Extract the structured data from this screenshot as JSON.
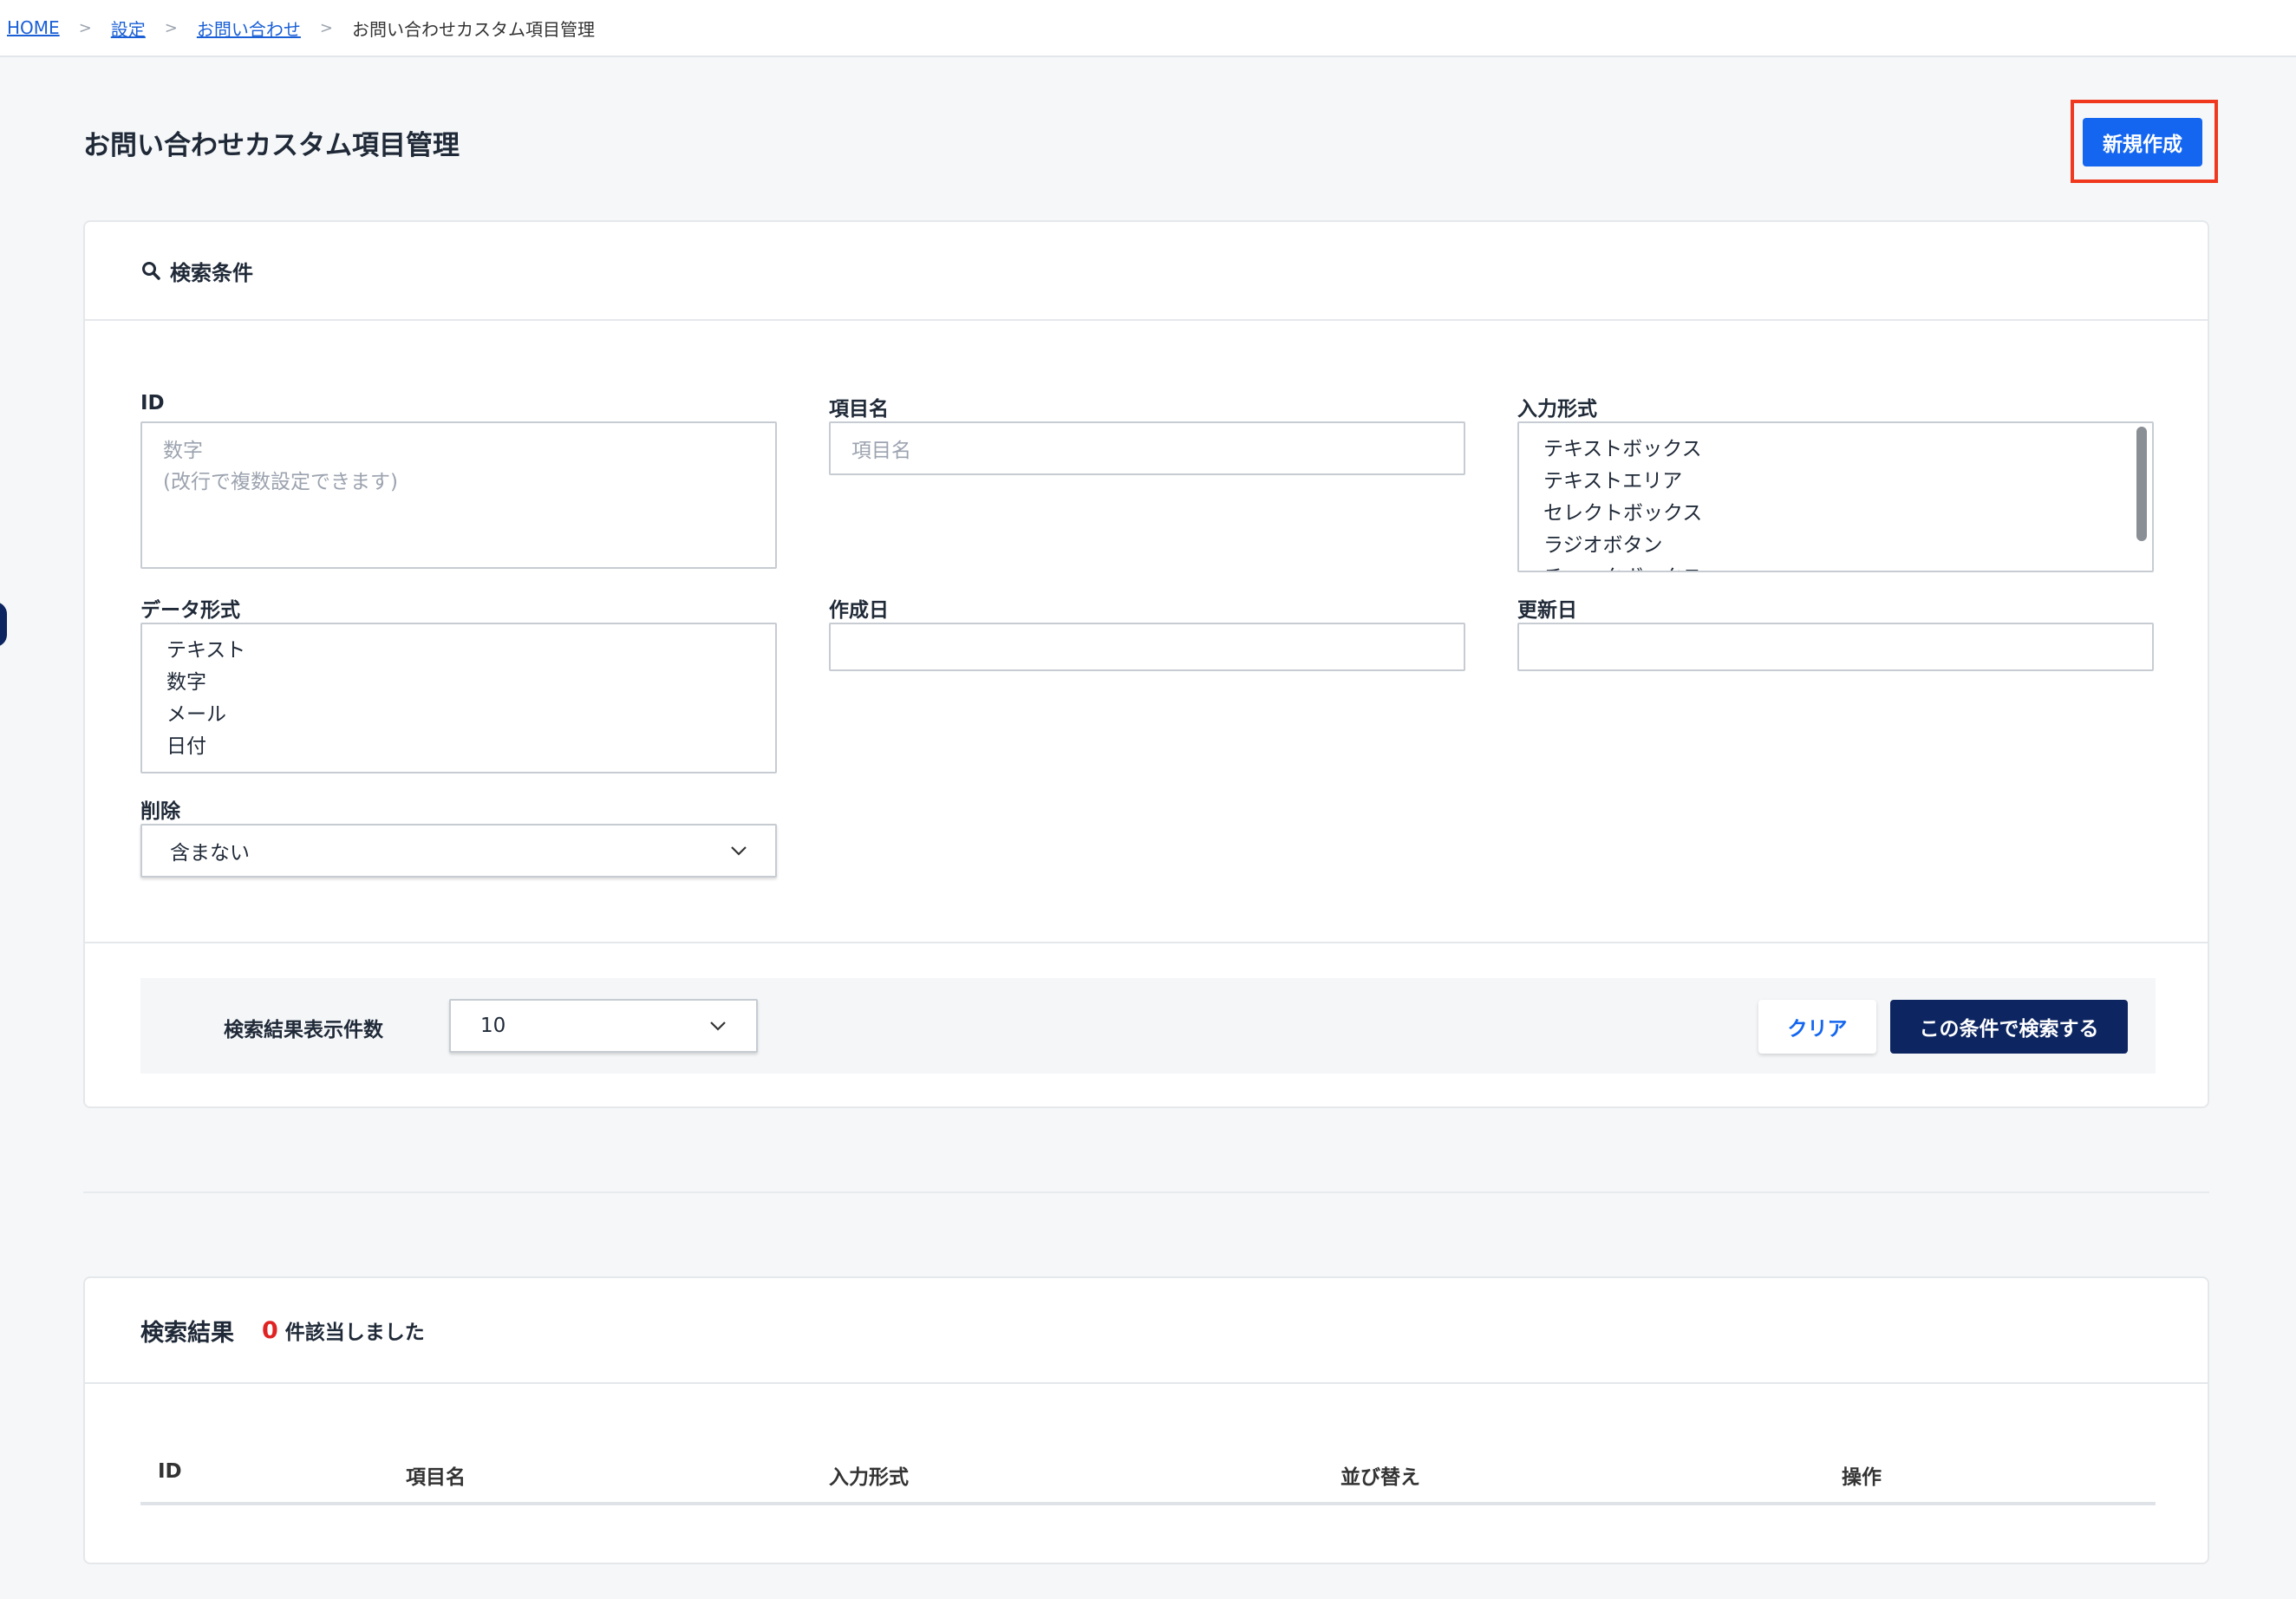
{
  "breadcrumb": {
    "home": "HOME",
    "settings": "設定",
    "contact": "お問い合わせ",
    "current": "お問い合わせカスタム項目管理",
    "separator": ">"
  },
  "header": {
    "title": "お問い合わせカスタム項目管理",
    "new_button": "新規作成"
  },
  "search": {
    "heading": "検索条件",
    "id": {
      "label": "ID",
      "placeholder_line1": "数字",
      "placeholder_line2": "(改行で複数設定できます)"
    },
    "item_name": {
      "label": "項目名",
      "placeholder": "項目名"
    },
    "input_type": {
      "label": "入力形式",
      "options": [
        "テキストボックス",
        "テキストエリア",
        "セレクトボックス",
        "ラジオボタン",
        "チェックボックス"
      ]
    },
    "data_type": {
      "label": "データ形式",
      "options": [
        "テキスト",
        "数字",
        "メール",
        "日付"
      ]
    },
    "created": {
      "label": "作成日",
      "value": ""
    },
    "updated": {
      "label": "更新日",
      "value": ""
    },
    "deleted": {
      "label": "削除",
      "selected": "含まない"
    },
    "rows_label": "検索結果表示件数",
    "rows_selected": "10",
    "clear_button": "クリア",
    "search_button": "この条件で検索する"
  },
  "results": {
    "title": "検索結果",
    "count": "0",
    "suffix": "件該当しました",
    "columns": [
      "ID",
      "項目名",
      "入力形式",
      "並び替え",
      "操作"
    ]
  },
  "colors": {
    "primary": "#1466f0",
    "navy": "#0d2561",
    "highlight": "#f0381f",
    "count": "#e02424"
  }
}
